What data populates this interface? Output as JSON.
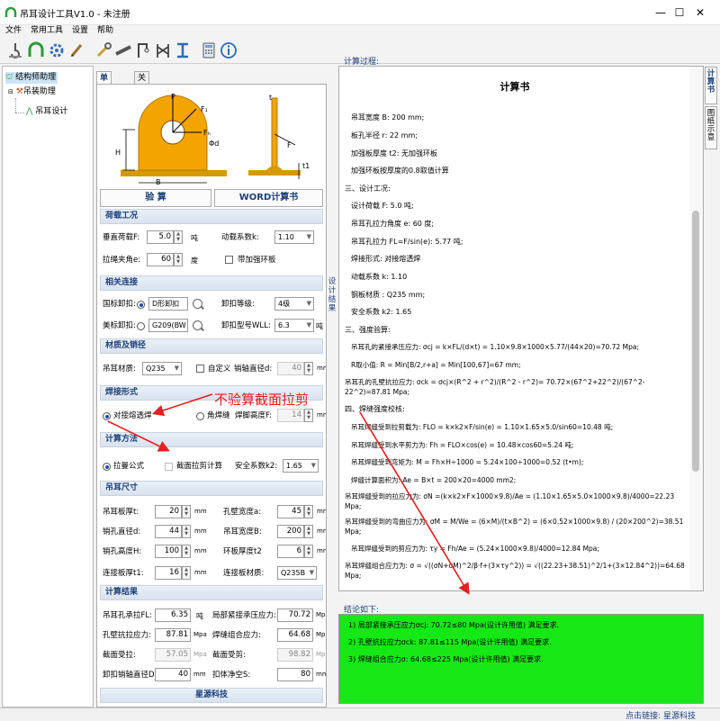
{
  "window": {
    "title": "吊耳设计工具V1.0 - 未注册",
    "minimize": "—",
    "maximize": "☐",
    "close": "✕"
  },
  "menu": [
    "文件",
    "常用工具",
    "设置",
    "帮助"
  ],
  "toolbar_icons": [
    "hook-icon",
    "arch-icon",
    "gear-icon",
    "brush-icon",
    "wrench-icon",
    "beam-icon",
    "crane-icon",
    "frame-icon",
    "i-beam-icon",
    "calculator-icon",
    "info-icon"
  ],
  "tree": {
    "root": "结构师助理",
    "child": "吊装助理",
    "leaf": "吊耳设计"
  },
  "tabs": [
    "单板吊耳",
    "关于注册"
  ],
  "buttons": {
    "calc": "验    算",
    "word": "WORD计算书"
  },
  "sections": {
    "load": "荷载工况",
    "conn": "相关连接",
    "mat": "材质及销径",
    "weld": "焊接形式",
    "method": "计算方法",
    "size": "吊耳尺寸",
    "result": "计算结果"
  },
  "load": {
    "vertical_label": "垂直荷载F:",
    "vertical_value": "5.0",
    "vertical_unit": "吨",
    "dyn_label": "动载系数k:",
    "dyn_value": "1.10",
    "angle_label": "拉绳夹角e:",
    "angle_value": "60",
    "angle_unit": "度",
    "reinforce_label": "带加强环板"
  },
  "conn": {
    "gb_label": "国标卸扣:",
    "gb_value": "D形卸扣",
    "grade_label": "卸扣等级:",
    "grade_value": "4级",
    "us_label": "美标卸扣:",
    "us_value": "G209(BW",
    "model_label": "卸扣型号WLL:",
    "model_value": "6.3",
    "model_unit": "吨"
  },
  "mat": {
    "material_label": "吊耳材质:",
    "material_value": "Q235",
    "custom_label": "自定义",
    "pin_label": "销轴直径d:",
    "pin_value": "40",
    "pin_unit": "mm"
  },
  "weld": {
    "butt_label": "对接熔透焊",
    "fillet_label": "角焊缝",
    "height_label": "焊脚高度F:",
    "height_value": "14",
    "height_unit": "mm"
  },
  "method": {
    "tension_label": "拉曼公式",
    "shear_label": "截面拉剪计算",
    "safety_label": "安全系数k2:",
    "safety_value": "1.65"
  },
  "size": {
    "thk_label": "吊耳板厚t:",
    "thk_value": "20",
    "width_label": "孔壁宽度a:",
    "width_value": "45",
    "hole_label": "销孔直径d:",
    "hole_value": "44",
    "lugw_label": "吊耳宽度B:",
    "lugw_value": "200",
    "pinh_label": "销孔高度H:",
    "pinh_value": "100",
    "ring_label": "环板厚度t2",
    "ring_value": "6",
    "plate_label": "连接板厚t1:",
    "plate_value": "16",
    "plate_mat_label": "连接板材质:",
    "plate_mat_value": "Q235B",
    "unit": "mm"
  },
  "result": {
    "cap_label": "吊耳孔承拉FL:",
    "cap_value": "6.35",
    "cap_unit": "吨",
    "bear_label": "局部紧接承压应力:",
    "bear_value": "70.72",
    "bear_unit": "Mpa",
    "wall_label": "孔壁抗拉应力:",
    "wall_value": "87.81",
    "wall_unit": "Mpa",
    "weld_label": "焊缝组合应力:",
    "weld_value": "64.68",
    "weld_unit": "Mpa",
    "sec_tension_label": "截面受拉:",
    "sec_tension_value": "57.05",
    "sec_tension_unit": "Mpa",
    "sec_shear_label": "截面受剪:",
    "sec_shear_value": "98.82",
    "sec_shear_unit": "Mpa",
    "pin_label": "卸扣销轴直径D:",
    "pin_value": "40",
    "pin_unit": "mm",
    "clear_label": "扣体净空S:",
    "clear_value": "80",
    "clear_unit": "mm"
  },
  "footer_brand": "星源科技",
  "side_vertical": "设计结果",
  "process_label": "计算过程:",
  "doc": {
    "title": "计算书",
    "lines": [
      "吊耳宽度 B: 200 mm;",
      "板孔半径 r: 22 mm;",
      "加强板厚度 t2: 无加强环板",
      "加强环板按厚度的0.8取值计算",
      "三、设计工况:",
      "设计荷载 F: 5.0 吨;",
      "吊耳孔拉力角度 e: 60 度;",
      "吊耳孔拉力 FL=F/sin(e): 5.77 吨;",
      "焊接形式: 对接熔透焊",
      "动载系数 k: 1.10",
      "钢板材质 : Q235 mm;",
      "安全系数 k2: 1.65",
      "三、强度验算:",
      "吊耳孔的紧接承压应力: σcj = k×FL/(d×t) = 1.10×9.8×1000×5.77/(44×20)=70.72 Mpa;",
      "R取小值: R = Min[B/2,r+a] =  Min[100,67]=67 mm;",
      "吊耳孔的孔壁抗拉应力: σck = σcj×(R^2 + r^2)/(R^2 - r^2)= 70.72×(67^2+22^2)/(67^2-22^2)=87.81 Mpa;",
      "四、焊缝强度校核:",
      "吊耳焊缝受到拉剪载为: FLO = k×k2×F/sin(e) = 1.10×1.65×5.0/sin60=10.48 吨;",
      "吊耳焊缝受到水平剪力为: Fh = FLO×cos(e) = 10.48×cos60=5.24 吨;",
      "吊耳焊缝受到弯矩为: M = Fh×H÷1000 = 5.24×100÷1000=0.52 (t•m);",
      "焊缝计算面积为: Ae = B×t = 200×20=4000 mm2;",
      "吊耳焊缝受到的拉应力为: σN =(k×k2×F×1000×9.8)/Ae = (1.10×1.65×5.0×1000×9.8)/4000=22.23 Mpa;",
      "吊耳焊缝受到的弯曲应力为: σM = M/We = (6×M)/(t×B^2) = (6×0.52×1000×9.8) / (20×200^2)=38.51 Mpa;",
      "吊耳焊缝受到的剪应力为: τy = Fh/Ae = (5.24×1000×9.8)/4000=12.84 Mpa;",
      "吊耳焊缝组合应力为: σ = √((σN+σM)^2/β·f+(3×τy^2)) = √((22.23+38.51)^2/1+(3×12.84^2))=64.68 Mpa;"
    ]
  },
  "conclusion_label": "结论如下:",
  "conclusions": [
    "1) 局部紧接承压应力σcj: 70.72≤80 Mpa(设计许用值) 满足要求.",
    "2) 孔壁抗拉应力σck: 87.81≤115 Mpa(设计许用值) 满足要求.",
    "3) 焊缝组合应力σ: 64.68≤225 Mpa(设计许用值) 满足要求."
  ],
  "right_tabs": [
    "计算书",
    "图纸示意"
  ],
  "status_text": "点击链接: 星源科技",
  "annotation": "不验算截面拉剪",
  "colors": {
    "accent": "#1c3f79",
    "conclusion_bg": "#16e816",
    "annotation": "#e32020",
    "lug": "#f2a500"
  }
}
